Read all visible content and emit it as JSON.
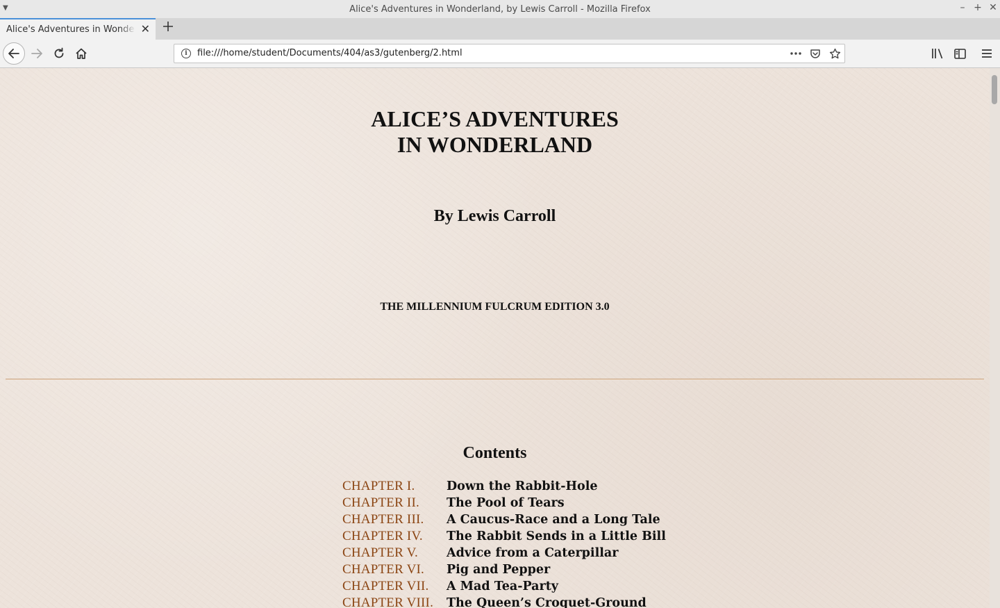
{
  "window": {
    "title": "Alice's Adventures in Wonderland, by Lewis Carroll - Mozilla Firefox"
  },
  "tabs": [
    {
      "label": "Alice's Adventures in Wonderland, by Lewis Carroll",
      "active": true
    }
  ],
  "navbar": {
    "url": "file:///home/student/Documents/404/as3/gutenberg/2.html"
  },
  "page": {
    "title_line1": "ALICE’S ADVENTURES",
    "title_line2": "IN WONDERLAND",
    "author": "By Lewis Carroll",
    "edition": "THE MILLENNIUM FULCRUM EDITION 3.0",
    "contents_heading": "Contents",
    "chapters": [
      {
        "num": "CHAPTER I.",
        "title": "Down the Rabbit-Hole"
      },
      {
        "num": "CHAPTER II.",
        "title": "The Pool of Tears"
      },
      {
        "num": "CHAPTER III.",
        "title": "A Caucus-Race and a Long Tale"
      },
      {
        "num": "CHAPTER IV.",
        "title": "The Rabbit Sends in a Little Bill"
      },
      {
        "num": "CHAPTER V.",
        "title": "Advice from a Caterpillar"
      },
      {
        "num": "CHAPTER VI.",
        "title": "Pig and Pepper"
      },
      {
        "num": "CHAPTER VII.",
        "title": "A Mad Tea-Party"
      },
      {
        "num": "CHAPTER VIII.",
        "title": "The Queen’s Croquet-Ground"
      }
    ]
  },
  "colors": {
    "page_background": "#ede3db",
    "chapter_link": "#8b4513",
    "active_tab_accent": "#4a90d9"
  }
}
